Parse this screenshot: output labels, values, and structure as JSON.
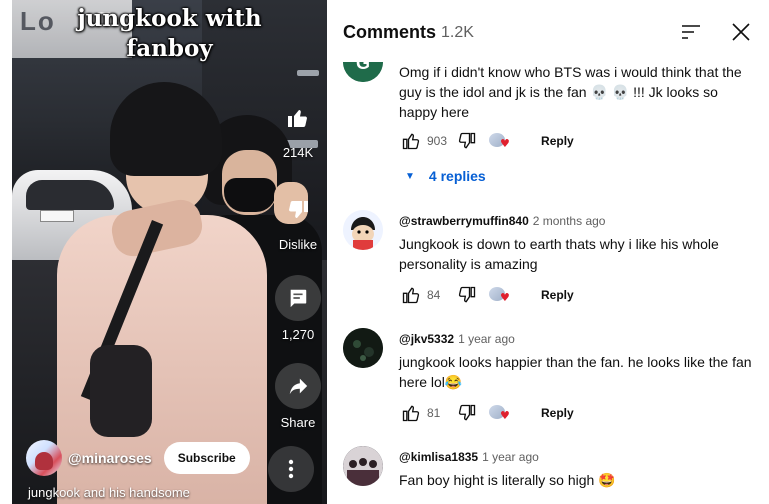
{
  "video": {
    "title_line1": "jungkook with",
    "title_line2": "fanboy",
    "bg_sign": "Lo",
    "like_count": "214K",
    "dislike_label": "Dislike",
    "comment_count": "1,270",
    "share_label": "Share",
    "channel": "@minaroses",
    "subscribe_label": "Subscribe",
    "description": "jungkook and his handsome"
  },
  "panel": {
    "title": "Comments",
    "count": "1.2K",
    "icons": {
      "sort": "sort-icon",
      "close": "close-icon"
    }
  },
  "comments": [
    {
      "text": "Omg if i didn't know who BTS was i would think that the guy is the idol and jk is the fan 💀 💀 !!! Jk looks so happy here",
      "likes": "903",
      "reply_label": "Reply",
      "replies_label": "4 replies",
      "avatar_color": "#1f6b4a"
    },
    {
      "author": "@strawberrymuffin840",
      "time": "2 months ago",
      "text": "Jungkook is down to earth thats why i like his whole personality is amazing",
      "likes": "84",
      "reply_label": "Reply",
      "avatar_color": "#f2d5b8"
    },
    {
      "author": "@jkv5332",
      "time": "1 year ago",
      "text": "jungkook looks happier than the fan. he looks like the fan here lol😂",
      "likes": "81",
      "reply_label": "Reply",
      "avatar_color": "#142018"
    },
    {
      "author": "@kimlisa1835",
      "time": "1 year ago",
      "text": "Fan boy hight is literally so high 🤩",
      "avatar_color": "#3b3a44"
    }
  ],
  "colors": {
    "link": "#065fd4",
    "heart": "#e0202e",
    "meta": "#606060"
  }
}
